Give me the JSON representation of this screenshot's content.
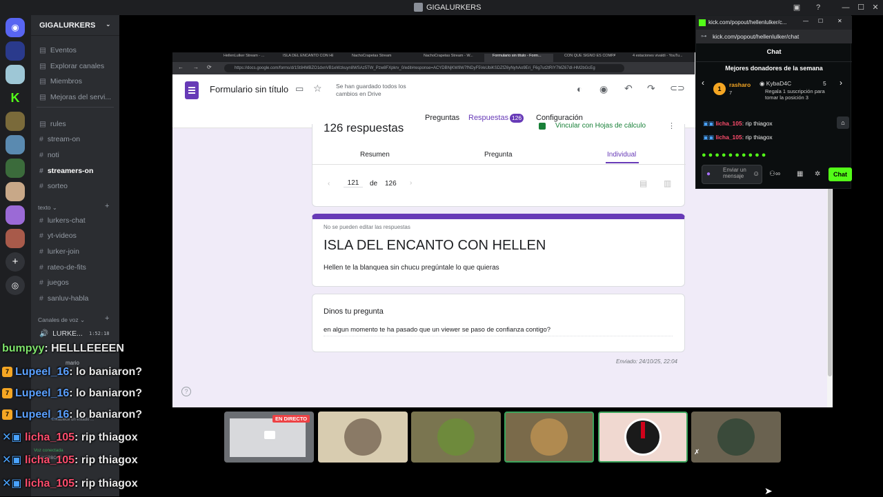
{
  "window": {
    "title": "GIGALURKERS"
  },
  "discord": {
    "guild_name": "GIGALURKERS",
    "menu": [
      "Eventos",
      "Explorar canales",
      "Miembros",
      "Mejoras del servi..."
    ],
    "channels": [
      "rules",
      "stream-on",
      "noti",
      "streamers-on",
      "sorteo"
    ],
    "text_category": "texto",
    "text_channels": [
      "lurkers-chat",
      "yt-videos",
      "lurker-join",
      "rateo-de-fits",
      "juegos",
      "sanluv-habla"
    ],
    "voice_category": "Canales de voz",
    "voice_channel": "LURKE...",
    "voice_timer": "1:52:18",
    "voice_users": [
      "mario"
    ],
    "status_placeholder": "Establece un estado ...",
    "conn_status": "Voz conectada",
    "user_tag": "LURKERBOSS INC..."
  },
  "browser": {
    "tabs": [
      "HellenLulker Stream - ...",
      "ISLA DEL ENCANTO CON HE...",
      "NachoCrapetas Stream",
      "NachoCrapetas Stream - W...",
      "Formulario sin título - Form...",
      "CON QUE SIGNO ES COMPA...",
      "4 estaciones vivaldi - YouTu..."
    ],
    "url": "https://docs.google.com/forms/d/1St84MBZO1dxnVB1eWzkuyn8WSAz5TW_Pzw8FXpkrv_0/edit#response=ACYDBNjKW9W7fNDyF5VeUbiKSDZfZ6yNyhAo9Eri_F6g7ut2tRIY7MZ67dI-HM2bGcEg"
  },
  "forms": {
    "title": "Formulario sin título",
    "save_status": "Se han guardado todos los cambios en Drive",
    "tabs": {
      "questions": "Preguntas",
      "responses": "Respuestas",
      "responses_count": "126",
      "settings": "Configuración"
    },
    "responses_heading": "126 respuestas",
    "link_sheets": "Vincular con Hojas de cálculo",
    "subtabs": {
      "summary": "Resumen",
      "question": "Pregunta",
      "individual": "Individual"
    },
    "pager": {
      "current": "121",
      "of": "de",
      "total": "126"
    },
    "note": "No se pueden editar las respuestas",
    "form_title": "ISLA DEL ENCANTO CON HELLEN",
    "form_desc": "Hellen te la blanquea sin chucu pregúntale lo que quieras",
    "question_label": "Dinos tu pregunta",
    "answer": "en algun momento te ha pasado que un viewer se paso de confianza contigo?",
    "sent": "Enviado: 24/10/25, 22:04"
  },
  "kick": {
    "window_url": "kick.com/popout/hellenlulker/c...",
    "url": "kick.com/popout/hellenlulker/chat",
    "header": "Chat",
    "donors_title": "Mejores donadores de la semana",
    "donor1": {
      "rank": "1",
      "name": "rasharo",
      "count": "7"
    },
    "donor2": {
      "name": "KybaD4C",
      "count": "5"
    },
    "donor_cta": "Regala 1 suscripción para tomar la posición 3",
    "messages": [
      {
        "user": "licha_105",
        "text": "rip thiagox"
      },
      {
        "user": "licha_105",
        "text": "rip thiagox"
      }
    ],
    "input_placeholder": "Enviar un mensaje",
    "chat_button": "Chat"
  },
  "cams": {
    "live_badge": "EN DIRECTO"
  },
  "overlay_chat": [
    {
      "user": "bumpyy",
      "text": ": HELLLEEEEN",
      "kind": "green"
    },
    {
      "user": "Lupeel_16",
      "text": ": lo baniaron?",
      "kind": "badge"
    },
    {
      "user": "Lupeel_16",
      "text": ": lo baniaron?",
      "kind": "badge"
    },
    {
      "user": "Lupeel_16",
      "text": ": lo baniaron?",
      "kind": "badge"
    },
    {
      "user": "licha_105",
      "text": ": rip thiagox",
      "kind": "kick"
    },
    {
      "user": "licha_105",
      "text": ": rip thiagox",
      "kind": "kick"
    },
    {
      "user": "licha_105",
      "text": ": rip thiagox",
      "kind": "kick"
    }
  ],
  "colors": {
    "forms_purple": "#673ab7",
    "discord_bg": "#2b2d31",
    "kick_green": "#53fc18"
  }
}
